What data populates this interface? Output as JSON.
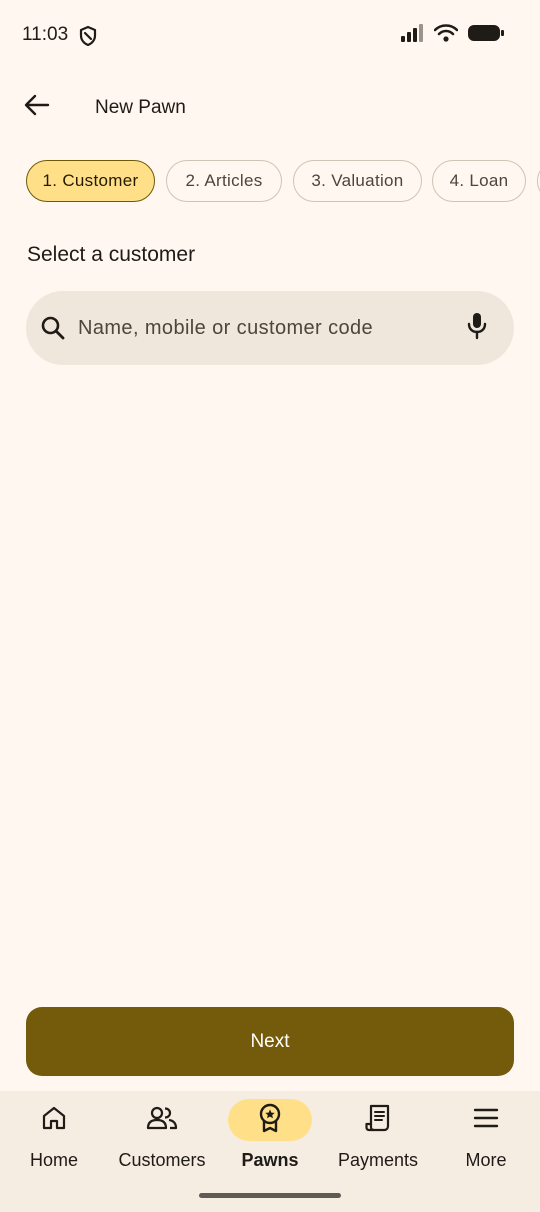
{
  "status_bar": {
    "time": "11:03",
    "icons": [
      "shield-icon",
      "signal-icon",
      "wifi-icon",
      "battery-icon"
    ]
  },
  "app_bar": {
    "title": "New Pawn",
    "back_icon": "arrow-left-icon"
  },
  "steps": [
    {
      "label": "1. Customer",
      "active": true
    },
    {
      "label": "2. Articles",
      "active": false
    },
    {
      "label": "3. Valuation",
      "active": false
    },
    {
      "label": "4. Loan",
      "active": false
    },
    {
      "label": "",
      "active": false
    }
  ],
  "section": {
    "title": "Select a customer"
  },
  "search": {
    "placeholder": "Name, mobile or customer code",
    "value": "",
    "leading_icon": "search-icon",
    "trailing_icon": "mic-icon"
  },
  "actions": {
    "next_label": "Next"
  },
  "bottom_nav": {
    "items": [
      {
        "label": "Home",
        "icon": "home-icon",
        "active": false
      },
      {
        "label": "Customers",
        "icon": "people-icon",
        "active": false
      },
      {
        "label": "Pawns",
        "icon": "badge-icon",
        "active": true
      },
      {
        "label": "Payments",
        "icon": "receipt-icon",
        "active": false
      },
      {
        "label": "More",
        "icon": "menu-icon",
        "active": false
      }
    ]
  },
  "colors": {
    "background": "#FFF7F0",
    "accent_container": "#FFE089",
    "primary": "#735B0B",
    "surface_variant": "#EFE6DC",
    "nav_background": "#F5ECE2"
  }
}
